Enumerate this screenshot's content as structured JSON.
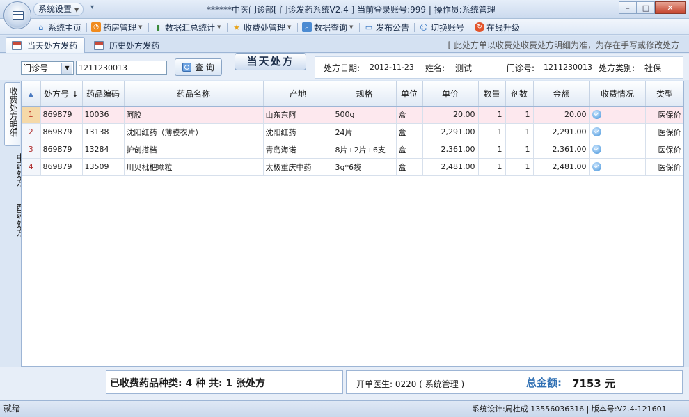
{
  "app": {
    "quick_menu_label": "系统设置",
    "quick_extra": "▾",
    "title": "******中医门诊部[ 门诊发药系统V2.4 ]    当前登录账号:999 | 操作员:系统管理",
    "window_buttons": {
      "minimize": "–",
      "maximize": "□",
      "close": "✕"
    }
  },
  "menu": [
    {
      "label": "系统主页",
      "icon": "home-icon"
    },
    {
      "label": "药房管理",
      "icon": "rss-icon",
      "dropdown": true
    },
    {
      "label": "数据汇总统计",
      "icon": "bar-chart-icon",
      "dropdown": true
    },
    {
      "label": "收费处管理",
      "icon": "star-icon",
      "dropdown": true
    },
    {
      "label": "数据查询",
      "icon": "search-icon",
      "dropdown": true
    },
    {
      "label": "发布公告",
      "icon": "chat-icon"
    },
    {
      "label": "切换账号",
      "icon": "user-icon"
    },
    {
      "label": "在线升级",
      "icon": "update-icon"
    }
  ],
  "tabs": [
    {
      "label": "当天处方发药",
      "active": true
    },
    {
      "label": "历史处方发药",
      "active": false
    }
  ],
  "notice": "[ 此处方单以收费处收费处方明细为准，为存在手写或修改处方",
  "search": {
    "field_select": "门诊号",
    "input_value": "1211230013",
    "query_button": "查 询",
    "section_label": "当天处方"
  },
  "info": {
    "date_label": "处方日期:",
    "date_value": "2012-11-23",
    "name_label": "姓名:",
    "name_value": "测试",
    "clinic_label": "门诊号:",
    "clinic_value": "1211230013",
    "type_label": "处方类别:",
    "type_value": "社保"
  },
  "side_tabs": [
    {
      "label": "收费处方明细",
      "active": true
    },
    {
      "label": "中药处方",
      "active": false
    },
    {
      "label": "西药处方",
      "active": false
    }
  ],
  "table": {
    "columns": [
      "",
      "处方号",
      "药品编码",
      "药品名称",
      "产地",
      "规格",
      "单位",
      "单价",
      "数量",
      "剂数",
      "金额",
      "收费情况",
      "类型"
    ],
    "sort_indicator": "↓",
    "rows": [
      {
        "idx": "1",
        "rx": "869879",
        "code": "10036",
        "name": "阿胶",
        "origin": "山东东阿",
        "spec": "500g",
        "unit": "盒",
        "price": "20.00",
        "qty": "1",
        "dose": "1",
        "amount": "20.00",
        "paid": true,
        "type": "医保价"
      },
      {
        "idx": "2",
        "rx": "869879",
        "code": "13138",
        "name": "沈阳红药（薄膜衣片）",
        "origin": "沈阳红药",
        "spec": "24片",
        "unit": "盒",
        "price": "2,291.00",
        "qty": "1",
        "dose": "1",
        "amount": "2,291.00",
        "paid": true,
        "type": "医保价"
      },
      {
        "idx": "3",
        "rx": "869879",
        "code": "13284",
        "name": "护创搭档",
        "origin": "青岛海诺",
        "spec": "8片+2片+6支",
        "unit": "盒",
        "price": "2,361.00",
        "qty": "1",
        "dose": "1",
        "amount": "2,361.00",
        "paid": true,
        "type": "医保价"
      },
      {
        "idx": "4",
        "rx": "869879",
        "code": "13509",
        "name": "川贝枇杷颗粒",
        "origin": "太极重庆中药",
        "spec": "3g*6袋",
        "unit": "盒",
        "price": "2,481.00",
        "qty": "1",
        "dose": "1",
        "amount": "2,481.00",
        "paid": true,
        "type": "医保价"
      }
    ]
  },
  "summary": {
    "left_text": "已收费药品种类: 4 种    共: 1 张处方",
    "doctor_text": "开单医生:  0220  ( 系统管理 )",
    "total_label": "总金额:",
    "total_value": "7153 元"
  },
  "status": {
    "left": "就绪",
    "right": "系统设计:周杜成 13556036316  |  版本号:V2.4-121601"
  },
  "colors": {
    "accent": "#2f6fb3",
    "selected_row": "#fde8ee",
    "paid_icon": "#3e8fd8"
  }
}
